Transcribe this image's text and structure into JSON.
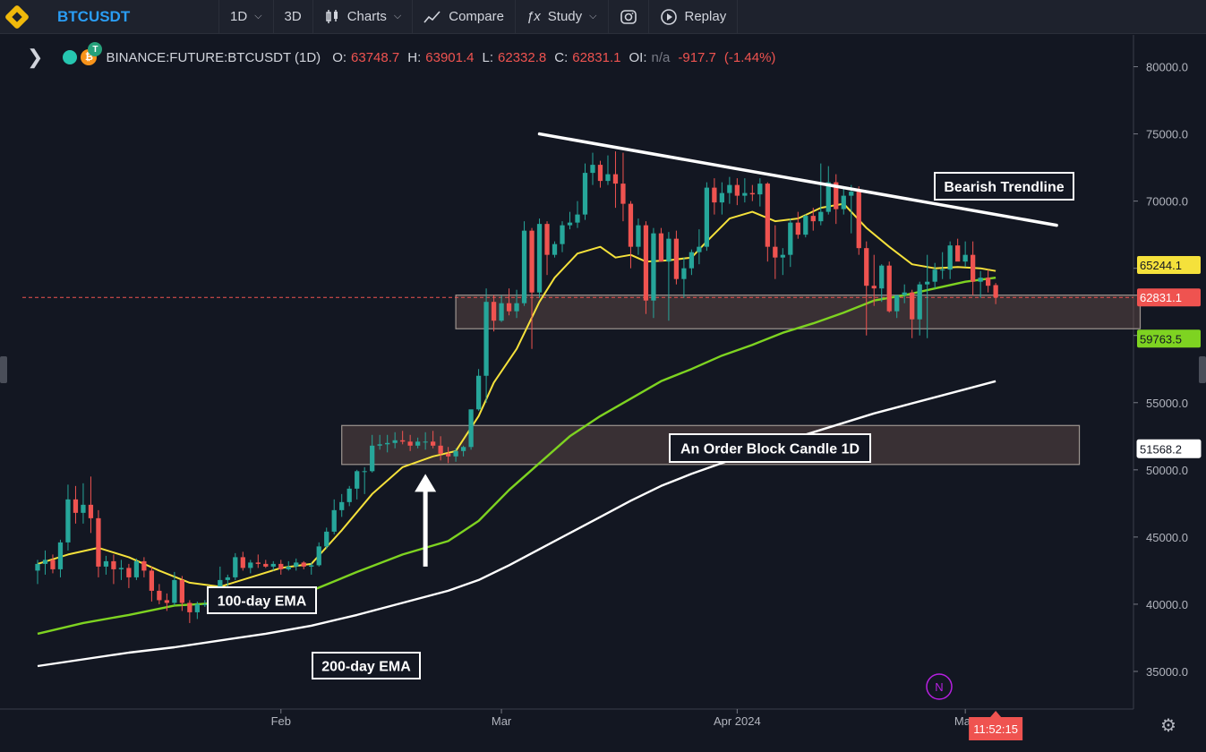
{
  "toolbar": {
    "symbol": "BTCUSDT",
    "interval": "1D",
    "interval_alt": "3D",
    "charts_label": "Charts",
    "compare_label": "Compare",
    "study_label": "Study",
    "replay_label": "Replay"
  },
  "legend": {
    "symbol": "BINANCE:FUTURE:BTCUSDT (1D)",
    "o_label": "O:",
    "o_value": "63748.7",
    "h_label": "H:",
    "h_value": "63901.4",
    "l_label": "L:",
    "l_value": "62332.8",
    "c_label": "C:",
    "c_value": "62831.1",
    "oi_label": "OI:",
    "oi_value": "n/a",
    "change": "-917.7",
    "change_pct": "(-1.44%)"
  },
  "colors": {
    "background": "#131722",
    "up_candle": "#26a69a",
    "down_candle": "#ef5350",
    "ema_fast": "#f5e13b",
    "ema_100": "#7ed321",
    "ema_200": "#ffffff",
    "symbol_blue": "#2a9df4"
  },
  "chart_data": {
    "type": "candlestick",
    "title": "",
    "price_axis": {
      "ticks": [
        "80000.0",
        "75000.0",
        "70000.0",
        "65000.0",
        "60000.0",
        "55000.0",
        "50000.0",
        "45000.0",
        "40000.0",
        "35000.0"
      ],
      "ylim": [
        32200,
        82300
      ]
    },
    "time_axis": {
      "ticks": [
        {
          "label": "Feb",
          "day": 32
        },
        {
          "label": "Mar",
          "day": 61
        },
        {
          "label": "Apr 2024",
          "day": 92
        },
        {
          "label": "May",
          "day": 122
        }
      ],
      "xlim_days": [
        -2,
        144
      ]
    },
    "last_price": 62831.1,
    "price_labels": [
      {
        "label": "65244.1",
        "value": 65244.1,
        "color": "#f5e13b"
      },
      {
        "label": "62831.1",
        "value": 62831.1,
        "color": "#ef5350"
      },
      {
        "label": "59763.5",
        "value": 59763.5,
        "color": "#7ed321"
      },
      {
        "label": "51568.2",
        "value": 51568.2,
        "color": "#ffffff"
      }
    ],
    "countdown": "11:52:15",
    "candles": [
      [
        0,
        42500,
        43300,
        41500,
        43000
      ],
      [
        1,
        43000,
        44000,
        42200,
        43300
      ],
      [
        2,
        43300,
        43700,
        42300,
        42600
      ],
      [
        3,
        42600,
        44800,
        42000,
        44600
      ],
      [
        4,
        44600,
        48900,
        44000,
        47800
      ],
      [
        5,
        47800,
        48800,
        46000,
        46800
      ],
      [
        6,
        46800,
        49000,
        46000,
        47400
      ],
      [
        7,
        47400,
        49500,
        45300,
        46400
      ],
      [
        8,
        46400,
        47000,
        42000,
        42800
      ],
      [
        9,
        42800,
        43600,
        42200,
        43200
      ],
      [
        10,
        43200,
        43700,
        41500,
        42600
      ],
      [
        11,
        42600,
        43300,
        41800,
        42700
      ],
      [
        12,
        42700,
        43000,
        41200,
        42000
      ],
      [
        13,
        42000,
        43400,
        41800,
        43200
      ],
      [
        14,
        43200,
        43500,
        42000,
        42500
      ],
      [
        15,
        42500,
        42800,
        40200,
        41000
      ],
      [
        16,
        41000,
        41500,
        40000,
        40300
      ],
      [
        17,
        40300,
        40800,
        39500,
        40100
      ],
      [
        18,
        40100,
        42400,
        39900,
        41800
      ],
      [
        19,
        41800,
        42100,
        39500,
        40100
      ],
      [
        20,
        40100,
        40300,
        38600,
        39400
      ],
      [
        21,
        39400,
        40200,
        38900,
        40000
      ],
      [
        22,
        40000,
        40300,
        39800,
        40000
      ],
      [
        23,
        40000,
        40400,
        39600,
        40100
      ],
      [
        24,
        40100,
        42800,
        39900,
        41800
      ],
      [
        25,
        41800,
        42200,
        41300,
        42000
      ],
      [
        26,
        42000,
        43800,
        41800,
        43500
      ],
      [
        27,
        43500,
        43900,
        42500,
        42700
      ],
      [
        28,
        42700,
        43300,
        42300,
        43100
      ],
      [
        29,
        43100,
        43700,
        42700,
        43000
      ],
      [
        30,
        43000,
        43300,
        42700,
        42800
      ],
      [
        31,
        42800,
        43200,
        42500,
        43000
      ],
      [
        32,
        43000,
        43300,
        42200,
        42600
      ],
      [
        33,
        42600,
        43200,
        42500,
        42800
      ],
      [
        34,
        42800,
        43400,
        42500,
        43100
      ],
      [
        35,
        43100,
        43200,
        42600,
        42800
      ],
      [
        36,
        42800,
        43100,
        42200,
        42900
      ],
      [
        37,
        42900,
        44600,
        42800,
        44300
      ],
      [
        38,
        44300,
        45700,
        44100,
        45400
      ],
      [
        39,
        45400,
        47800,
        45200,
        47000
      ],
      [
        40,
        47000,
        48200,
        46500,
        47600
      ],
      [
        41,
        47600,
        48800,
        47300,
        48600
      ],
      [
        42,
        48600,
        50000,
        47800,
        49900
      ],
      [
        43,
        49900,
        50200,
        48200,
        49900
      ],
      [
        44,
        49900,
        52600,
        49800,
        51800
      ],
      [
        45,
        51800,
        52600,
        51500,
        51900
      ],
      [
        46,
        51900,
        52600,
        51300,
        52000
      ],
      [
        47,
        52000,
        52800,
        51600,
        52200
      ],
      [
        48,
        52200,
        52900,
        51900,
        52100
      ],
      [
        49,
        52100,
        52600,
        51400,
        51800
      ],
      [
        50,
        51800,
        52400,
        51600,
        52100
      ],
      [
        51,
        52100,
        52800,
        51500,
        52100
      ],
      [
        52,
        52100,
        52900,
        51600,
        51800
      ],
      [
        53,
        51800,
        52500,
        50700,
        51200
      ],
      [
        54,
        51200,
        51700,
        50500,
        51000
      ],
      [
        55,
        51000,
        51600,
        50600,
        51400
      ],
      [
        56,
        51400,
        51800,
        51000,
        51700
      ],
      [
        57,
        51700,
        54000,
        51500,
        54500
      ],
      [
        58,
        54500,
        57500,
        54400,
        57000
      ],
      [
        59,
        57000,
        63500,
        55000,
        62500
      ],
      [
        60,
        62500,
        63000,
        60300,
        61100
      ],
      [
        61,
        61100,
        63000,
        61000,
        62400
      ],
      [
        62,
        62400,
        63500,
        61500,
        61800
      ],
      [
        63,
        61800,
        63400,
        61300,
        62400
      ],
      [
        64,
        62400,
        68500,
        62200,
        67800
      ],
      [
        65,
        67800,
        68000,
        59000,
        63200
      ],
      [
        66,
        63200,
        68700,
        62800,
        68300
      ],
      [
        67,
        68300,
        68500,
        64500,
        66000
      ],
      [
        68,
        66000,
        67000,
        65800,
        66800
      ],
      [
        69,
        66800,
        68500,
        66200,
        68200
      ],
      [
        70,
        68200,
        69200,
        67900,
        68400
      ],
      [
        71,
        68400,
        70000,
        68000,
        69000
      ],
      [
        72,
        69000,
        72800,
        68600,
        72100
      ],
      [
        73,
        72100,
        73600,
        71200,
        72700
      ],
      [
        74,
        72700,
        73000,
        71000,
        71500
      ],
      [
        75,
        71500,
        73400,
        71200,
        72000
      ],
      [
        76,
        72000,
        73700,
        69500,
        71300
      ],
      [
        77,
        71300,
        73600,
        68500,
        69800
      ],
      [
        78,
        69800,
        70000,
        65000,
        66600
      ],
      [
        79,
        66600,
        68700,
        66000,
        68200
      ],
      [
        80,
        68200,
        68500,
        61600,
        62600
      ],
      [
        81,
        62600,
        68000,
        61300,
        67600
      ],
      [
        82,
        67600,
        68000,
        65500,
        65500
      ],
      [
        83,
        65500,
        67700,
        61100,
        67200
      ],
      [
        84,
        67200,
        67800,
        63800,
        64200
      ],
      [
        85,
        64200,
        65800,
        62800,
        65000
      ],
      [
        86,
        65000,
        66400,
        64500,
        66200
      ],
      [
        87,
        66200,
        67900,
        65300,
        66600
      ],
      [
        88,
        66600,
        71400,
        66300,
        71000
      ],
      [
        89,
        71000,
        71700,
        69000,
        69900
      ],
      [
        90,
        69900,
        71400,
        69000,
        70600
      ],
      [
        91,
        70600,
        71800,
        69800,
        71200
      ],
      [
        92,
        71200,
        71700,
        69700,
        70400
      ],
      [
        93,
        70400,
        71700,
        69900,
        70600
      ],
      [
        94,
        70600,
        71200,
        70000,
        70500
      ],
      [
        95,
        70500,
        71700,
        69600,
        71300
      ],
      [
        96,
        71300,
        71400,
        65500,
        66600
      ],
      [
        97,
        66600,
        68200,
        64200,
        65800
      ],
      [
        98,
        65800,
        66500,
        64500,
        66000
      ],
      [
        99,
        66000,
        68700,
        65100,
        68400
      ],
      [
        100,
        68400,
        69200,
        67200,
        67500
      ],
      [
        101,
        67500,
        69000,
        67300,
        68900
      ],
      [
        102,
        68900,
        69500,
        67800,
        68500
      ],
      [
        103,
        68500,
        72800,
        68200,
        69200
      ],
      [
        104,
        69200,
        72600,
        69000,
        71400
      ],
      [
        105,
        71400,
        72000,
        68300,
        69400
      ],
      [
        106,
        69400,
        71000,
        69000,
        70400
      ],
      [
        107,
        70400,
        71200,
        67600,
        70700
      ],
      [
        108,
        70700,
        71100,
        66000,
        66500
      ],
      [
        109,
        66500,
        67000,
        60000,
        63700
      ],
      [
        110,
        63700,
        66000,
        62200,
        63500
      ],
      [
        111,
        63500,
        65300,
        62500,
        65200
      ],
      [
        112,
        65200,
        65500,
        61700,
        61800
      ],
      [
        113,
        61800,
        63000,
        61300,
        63000
      ],
      [
        114,
        63000,
        63800,
        62400,
        63200
      ],
      [
        115,
        63200,
        63400,
        59800,
        61200
      ],
      [
        116,
        61200,
        64000,
        60000,
        63800
      ],
      [
        117,
        63800,
        66000,
        59800,
        64000
      ],
      [
        118,
        64000,
        65400,
        63500,
        64900
      ],
      [
        119,
        64900,
        66200,
        64200,
        64900
      ],
      [
        120,
        64900,
        67000,
        64200,
        66700
      ],
      [
        121,
        66700,
        67200,
        65700,
        65500
      ],
      [
        122,
        65500,
        67000,
        65100,
        66000
      ],
      [
        123,
        66000,
        67000,
        63000,
        64000
      ],
      [
        124,
        64000,
        64800,
        62800,
        64300
      ],
      [
        125,
        64300,
        64900,
        63200,
        63700
      ],
      [
        126,
        63748.7,
        63901.4,
        62332.8,
        62831.1
      ]
    ],
    "ema_fast": [
      [
        0,
        43000
      ],
      [
        4,
        43700
      ],
      [
        8,
        44200
      ],
      [
        12,
        43500
      ],
      [
        16,
        42500
      ],
      [
        20,
        41600
      ],
      [
        24,
        41300
      ],
      [
        28,
        42000
      ],
      [
        32,
        42700
      ],
      [
        36,
        43000
      ],
      [
        40,
        45500
      ],
      [
        44,
        48200
      ],
      [
        48,
        50200
      ],
      [
        52,
        51000
      ],
      [
        55,
        51400
      ],
      [
        58,
        54000
      ],
      [
        60,
        56500
      ],
      [
        63,
        59000
      ],
      [
        66,
        62500
      ],
      [
        68,
        64300
      ],
      [
        71,
        66100
      ],
      [
        74,
        66600
      ],
      [
        76,
        65800
      ],
      [
        78,
        66000
      ],
      [
        80,
        65500
      ],
      [
        83,
        65600
      ],
      [
        86,
        65800
      ],
      [
        88,
        67000
      ],
      [
        91,
        68700
      ],
      [
        94,
        69200
      ],
      [
        97,
        68500
      ],
      [
        100,
        68700
      ],
      [
        103,
        69500
      ],
      [
        106,
        69800
      ],
      [
        109,
        68000
      ],
      [
        112,
        66600
      ],
      [
        115,
        65300
      ],
      [
        118,
        65000
      ],
      [
        121,
        65100
      ],
      [
        124,
        65000
      ],
      [
        126,
        64800
      ]
    ],
    "ema_100": [
      [
        0,
        37800
      ],
      [
        6,
        38600
      ],
      [
        12,
        39200
      ],
      [
        18,
        39900
      ],
      [
        24,
        40100
      ],
      [
        30,
        40500
      ],
      [
        36,
        41000
      ],
      [
        42,
        42400
      ],
      [
        48,
        43700
      ],
      [
        54,
        44700
      ],
      [
        58,
        46200
      ],
      [
        62,
        48500
      ],
      [
        66,
        50500
      ],
      [
        70,
        52500
      ],
      [
        74,
        54000
      ],
      [
        78,
        55300
      ],
      [
        82,
        56600
      ],
      [
        86,
        57500
      ],
      [
        90,
        58500
      ],
      [
        94,
        59300
      ],
      [
        98,
        60200
      ],
      [
        102,
        60900
      ],
      [
        106,
        61700
      ],
      [
        110,
        62600
      ],
      [
        114,
        63000
      ],
      [
        118,
        63500
      ],
      [
        122,
        64000
      ],
      [
        126,
        64300
      ]
    ],
    "ema_200": [
      [
        0,
        35400
      ],
      [
        6,
        35900
      ],
      [
        12,
        36400
      ],
      [
        18,
        36800
      ],
      [
        24,
        37300
      ],
      [
        30,
        37800
      ],
      [
        36,
        38400
      ],
      [
        42,
        39200
      ],
      [
        48,
        40100
      ],
      [
        54,
        41000
      ],
      [
        58,
        41800
      ],
      [
        62,
        42900
      ],
      [
        66,
        44100
      ],
      [
        70,
        45300
      ],
      [
        74,
        46500
      ],
      [
        78,
        47700
      ],
      [
        82,
        48800
      ],
      [
        86,
        49700
      ],
      [
        90,
        50500
      ],
      [
        94,
        51300
      ],
      [
        98,
        52100
      ],
      [
        102,
        52800
      ],
      [
        106,
        53500
      ],
      [
        110,
        54200
      ],
      [
        114,
        54800
      ],
      [
        118,
        55400
      ],
      [
        122,
        56000
      ],
      [
        126,
        56600
      ]
    ],
    "annotations": {
      "trendline_label": "Bearish Trendline",
      "order_block_label": "An Order Block Candle 1D",
      "ema100_label": "100-day EMA",
      "ema200_label": "200-day EMA",
      "marker_letter": "N"
    },
    "zones": [
      {
        "x0": 55,
        "x1": 145,
        "y0": 60500,
        "y1": 63000
      },
      {
        "x0": 40,
        "x1": 137,
        "y0": 50400,
        "y1": 53300
      }
    ],
    "trendline": {
      "x0": 66,
      "y0": 75000,
      "x1": 134,
      "y1": 68200
    },
    "arrow": {
      "day": 51,
      "from": 42800,
      "to": 49700
    }
  }
}
